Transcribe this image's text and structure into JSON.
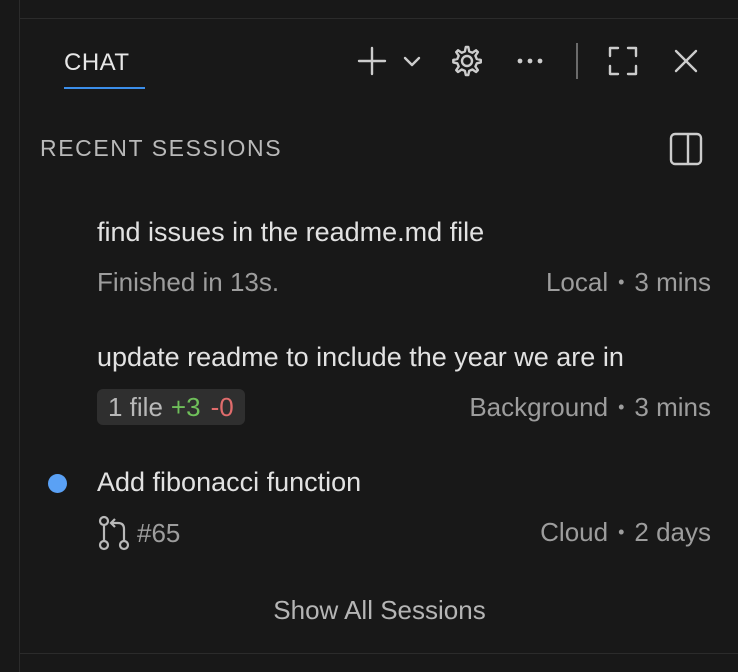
{
  "header": {
    "tab_label": "CHAT",
    "icons": [
      "plus-icon",
      "chevron-down-icon",
      "gear-icon",
      "more-icon",
      "maximize-icon",
      "close-icon"
    ]
  },
  "sessions_section": {
    "title": "RECENT SESSIONS",
    "toggle_icon": "sidebar-toggle-icon",
    "items": [
      {
        "title": "find issues in the readme.md file",
        "status": "Finished in 13s.",
        "location": "Local",
        "age": "3 mins",
        "unread": false
      },
      {
        "title": "update readme to include the year we are in",
        "changes": {
          "files": "1 file",
          "added": "+3",
          "removed": "-0"
        },
        "location": "Background",
        "age": "3 mins",
        "unread": false
      },
      {
        "title": "Add fibonacci function",
        "pr": "#65",
        "location": "Cloud",
        "age": "2 days",
        "unread": true
      }
    ],
    "show_all_label": "Show All Sessions"
  },
  "colors": {
    "background": "#181818",
    "accent": "#3b8eea",
    "unread_dot": "#5aa1f5",
    "added": "#6fbf5a",
    "removed": "#e06c6c"
  }
}
